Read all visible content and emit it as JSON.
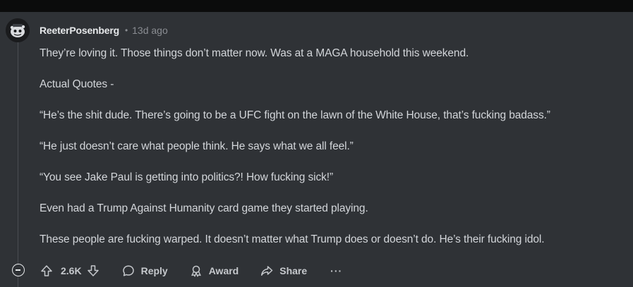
{
  "comment": {
    "username": "ReeterPosenberg",
    "separator": "•",
    "timestamp": "13d ago",
    "paragraphs": [
      "They’re loving it. Those things don’t matter now. Was at a MAGA household this weekend.",
      "Actual Quotes -",
      "“He’s the shit dude. There’s going to be a UFC fight on the lawn of the White House, that’s fucking badass.”",
      "“He just doesn’t care what people think. He says what we all feel.”",
      "“You see Jake Paul is getting into politics?! How fucking sick!”",
      "Even had a Trump Against Humanity card game they started playing.",
      "These people are fucking warped. It doesn’t matter what Trump does or doesn’t do. He’s their fucking idol."
    ]
  },
  "actions": {
    "score": "2.6K",
    "reply_label": "Reply",
    "award_label": "Award",
    "share_label": "Share",
    "more_label": "···"
  },
  "icons": {
    "upvote": "arrow-up-icon",
    "downvote": "arrow-down-icon",
    "reply": "speech-bubble-icon",
    "award": "award-ribbon-icon",
    "share": "share-arrow-icon",
    "collapse": "minus-circle-icon"
  },
  "colors": {
    "background": "#2f3236",
    "text": "#d3d6da",
    "muted": "#8a8d92",
    "username": "#e6e8ea"
  }
}
